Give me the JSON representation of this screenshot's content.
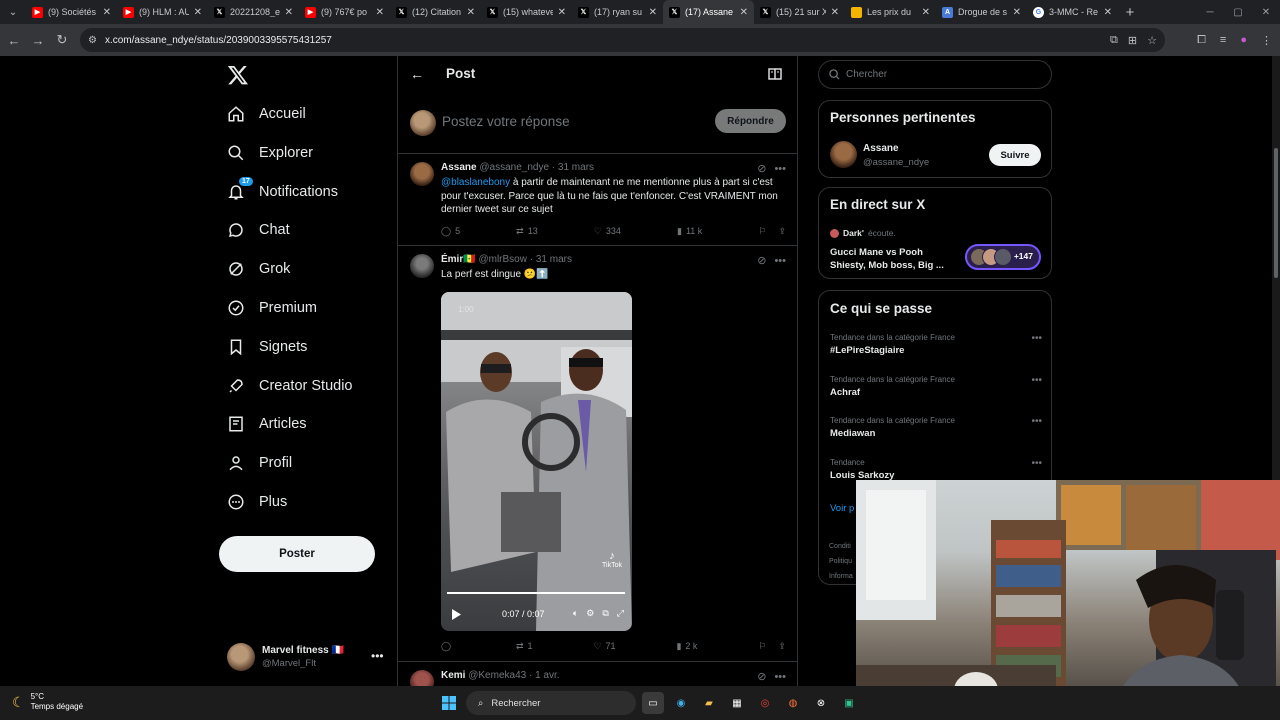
{
  "browser": {
    "tabs": [
      {
        "title": "(9) Sociétés",
        "icon": "youtube-icon",
        "color": "#ff0000",
        "active": false
      },
      {
        "title": "(9) HLM : AU",
        "icon": "youtube-icon",
        "color": "#ff0000",
        "active": false
      },
      {
        "title": "20221208_e",
        "icon": "x-icon",
        "color": "#000000",
        "active": false
      },
      {
        "title": "(9) 767€ po",
        "icon": "youtube-icon",
        "color": "#ff0000",
        "active": false
      },
      {
        "title": "(12) Citation",
        "icon": "x-icon",
        "color": "#000000",
        "active": false
      },
      {
        "title": "(15) whateve",
        "icon": "x-icon",
        "color": "#000000",
        "active": false
      },
      {
        "title": "(17) ryan su",
        "icon": "x-icon",
        "color": "#000000",
        "active": false
      },
      {
        "title": "(17) Assane",
        "icon": "x-icon",
        "color": "#000000",
        "active": true
      },
      {
        "title": "(15) 21 sur X",
        "icon": "x-icon",
        "color": "#000000",
        "active": false
      },
      {
        "title": "Les prix du",
        "icon": "bookmark-icon",
        "color": "#f4b400",
        "active": false
      },
      {
        "title": "Drogue de s",
        "icon": "a-icon",
        "color": "#4a7bd8",
        "active": false
      },
      {
        "title": "3-MMC - Re",
        "icon": "google-icon",
        "color": "#ffffff",
        "active": false
      }
    ],
    "url": "x.com/assane_ndye/status/2039003395575431257"
  },
  "leftnav": {
    "items": [
      {
        "label": "Accueil",
        "icon": "home-icon"
      },
      {
        "label": "Explorer",
        "icon": "search-icon"
      },
      {
        "label": "Notifications",
        "icon": "bell-icon",
        "badge": "17"
      },
      {
        "label": "Chat",
        "icon": "chat-icon"
      },
      {
        "label": "Grok",
        "icon": "grok-icon"
      },
      {
        "label": "Premium",
        "icon": "premium-icon"
      },
      {
        "label": "Signets",
        "icon": "bookmark-icon"
      },
      {
        "label": "Creator Studio",
        "icon": "rocket-icon"
      },
      {
        "label": "Articles",
        "icon": "article-icon"
      },
      {
        "label": "Profil",
        "icon": "person-icon"
      },
      {
        "label": "Plus",
        "icon": "more-circle-icon"
      }
    ],
    "post_button": "Poster",
    "account": {
      "name": "Marvel fitness 🇫🇷",
      "handle": "@Marvel_Flt"
    }
  },
  "header": {
    "title": "Post"
  },
  "reply": {
    "placeholder": "Postez votre réponse",
    "button": "Répondre"
  },
  "tweets": [
    {
      "name": "Assane",
      "handle": "@assane_ndye",
      "date": "· 31 mars",
      "mention": "@blaslanebony",
      "text": " à partir de maintenant ne me mentionne plus à part si c'est pour t'excuser. Parce que là tu ne fais que t'enfoncer. C'est VRAIMENT mon dernier tweet sur ce sujet",
      "replies": "5",
      "reposts": "13",
      "likes": "334",
      "views": "11 k"
    },
    {
      "name": "Émir🇸🇳",
      "handle": "@mlrBsow",
      "date": "· 31 mars",
      "text": "La perf est dingue 😕⬆️",
      "video": {
        "timestamp": "1:00",
        "time": "0:07 / 0:07",
        "watermark": "TikTok",
        "progress": 1.0
      },
      "replies": "",
      "reposts": "1",
      "likes": "71",
      "views": "2 k"
    },
    {
      "name": "Kemi",
      "handle": "@Kemeka43",
      "date": "· 1 avr."
    }
  ],
  "right": {
    "search_placeholder": "Chercher",
    "relevant": {
      "title": "Personnes pertinentes",
      "name": "Assane",
      "handle": "@assane_ndye",
      "follow": "Suivre"
    },
    "live": {
      "title": "En direct sur X",
      "host": "Dark'",
      "host_label": "écoute.",
      "space_title": "Gucci Mane vs Pooh Shiesty, Mob boss, Big ...",
      "count": "+147"
    },
    "trends": {
      "title": "Ce qui se passe",
      "items": [
        {
          "category": "Tendance dans la catégorie France",
          "name": "#LePireStagiaire"
        },
        {
          "category": "Tendance dans la catégorie France",
          "name": "Achraf"
        },
        {
          "category": "Tendance dans la catégorie France",
          "name": "Mediawan"
        },
        {
          "category": "Tendance",
          "name": "Louis Sarkozy"
        }
      ],
      "show_more": "Voir p"
    },
    "footer": [
      "Conditi",
      "Politiqu",
      "Informa"
    ]
  },
  "taskbar": {
    "temp": "5°C",
    "weather": "Temps dégagé",
    "search": "Rechercher"
  }
}
